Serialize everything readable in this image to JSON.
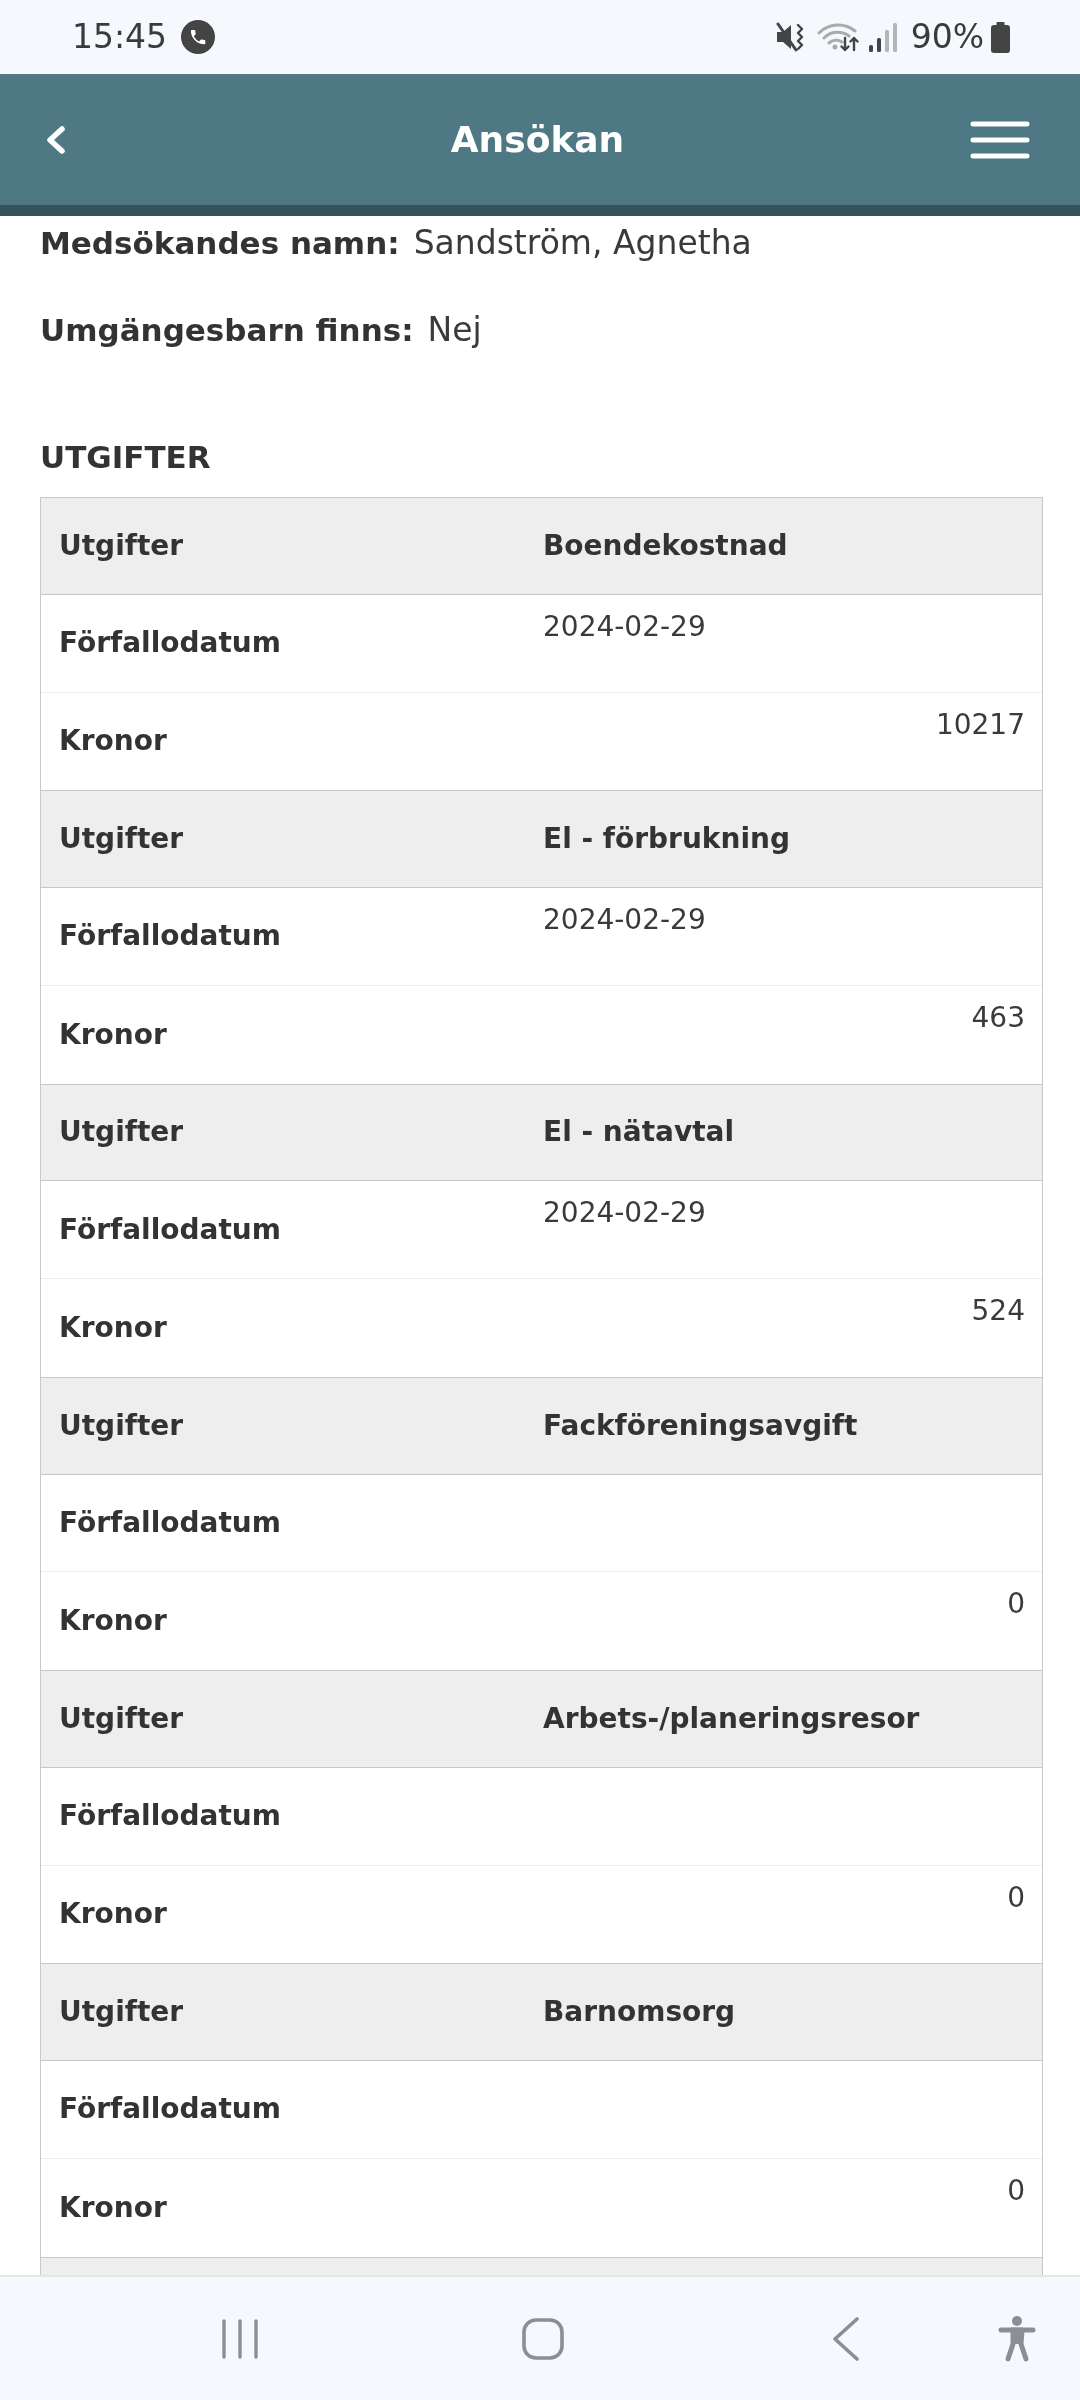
{
  "status_bar": {
    "time": "15:45",
    "battery": "90%"
  },
  "header": {
    "title": "Ansökan"
  },
  "details": [
    {
      "label": "Medsökandes namn:",
      "value": "Sandström, Agnetha"
    },
    {
      "label": "Umgängesbarn finns:",
      "value": "Nej"
    }
  ],
  "expenses_section": {
    "title": "UTGIFTER",
    "groups": [
      {
        "rows": [
          {
            "kind": "heading",
            "label": "Utgifter",
            "value": "Boendekostnad"
          },
          {
            "kind": "date",
            "label": "Förfallodatum",
            "value": "2024-02-29"
          },
          {
            "kind": "amount",
            "label": "Kronor",
            "value": "10217"
          }
        ]
      },
      {
        "rows": [
          {
            "kind": "heading",
            "label": "Utgifter",
            "value": "El - förbrukning"
          },
          {
            "kind": "date",
            "label": "Förfallodatum",
            "value": "2024-02-29"
          },
          {
            "kind": "amount",
            "label": "Kronor",
            "value": "463"
          }
        ]
      },
      {
        "rows": [
          {
            "kind": "heading",
            "label": "Utgifter",
            "value": "El - nätavtal"
          },
          {
            "kind": "date",
            "label": "Förfallodatum",
            "value": "2024-02-29"
          },
          {
            "kind": "amount",
            "label": "Kronor",
            "value": "524"
          }
        ]
      },
      {
        "rows": [
          {
            "kind": "heading",
            "label": "Utgifter",
            "value": "Fackföreningsavgift"
          },
          {
            "kind": "date",
            "label": "Förfallodatum"
          },
          {
            "kind": "amount",
            "label": "Kronor",
            "value": "0"
          }
        ]
      },
      {
        "rows": [
          {
            "kind": "heading",
            "label": "Utgifter",
            "value": "Arbets-/planeringsresor"
          },
          {
            "kind": "date",
            "label": "Förfallodatum"
          },
          {
            "kind": "amount",
            "label": "Kronor",
            "value": "0"
          }
        ]
      },
      {
        "rows": [
          {
            "kind": "heading",
            "label": "Utgifter",
            "value": "Barnomsorg"
          },
          {
            "kind": "date",
            "label": "Förfallodatum"
          },
          {
            "kind": "amount",
            "label": "Kronor",
            "value": "0"
          }
        ]
      },
      {
        "rows": [
          {
            "kind": "heading"
          }
        ]
      }
    ]
  }
}
